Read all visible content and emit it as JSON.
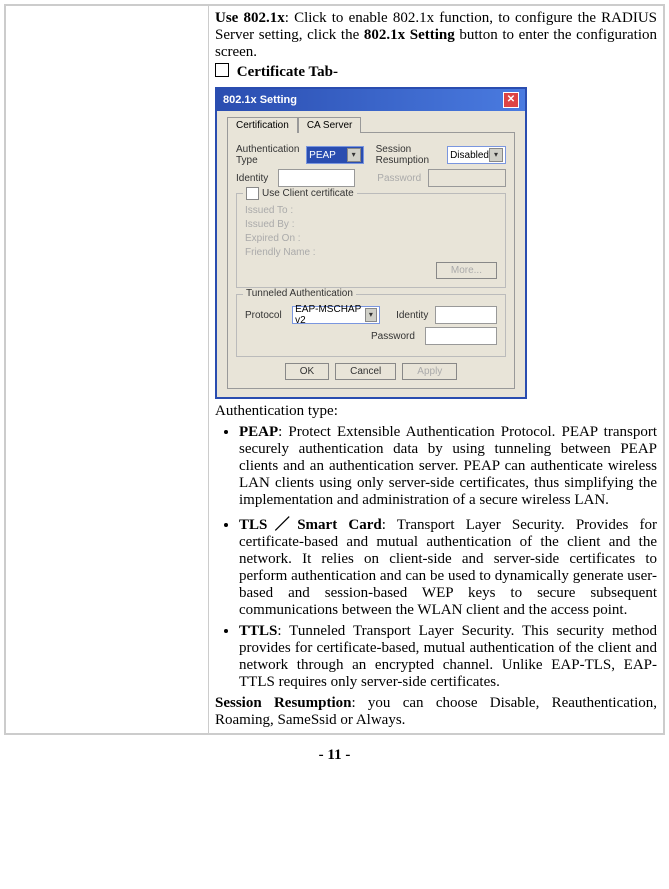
{
  "text": {
    "use8021x_label": "Use 802.1x",
    "use8021x_desc": ": Click to enable 802.1x function, to configure the RADIUS Server setting, click the ",
    "setting_bold": "802.1x Setting",
    "use8021x_tail": " button to enter the configuration screen.",
    "cert_tab": "Certificate Tab-",
    "auth_type_label": "Authentication type:",
    "peap_label": "PEAP",
    "peap_desc": ": Protect Extensible Authentication Protocol. PEAP transport securely authentication data by using tunneling between PEAP clients and an authentication server. PEAP can authenticate wireless LAN clients using only server-side certificates, thus simplifying the implementation and administration of a secure wireless LAN.",
    "tls_label": "TLS／Smart Card",
    "tls_desc": ": Transport Layer Security. Provides for certificate-based and mutual authentication of the client and the network. It relies on client-side and server-side certificates to perform authentication and can be used to dynamically generate user-based and session-based WEP keys to secure subsequent communications between the WLAN client and the access point.",
    "ttls_label": "TTLS",
    "ttls_desc": ": Tunneled Transport Layer Security. This security method provides for certificate-based, mutual authentication of the client and network through an encrypted channel. Unlike EAP-TLS, EAP-TTLS requires only server-side certificates.",
    "session_label": "Session Resumption",
    "session_desc": ": you can choose Disable, Reauthentication, Roaming, SameSsid or Always."
  },
  "dialog": {
    "title": "802.1x Setting",
    "tabs": {
      "cert": "Certification",
      "ca": "CA Server"
    },
    "auth_type": "Authentication Type",
    "auth_type_val": "PEAP",
    "session_resumption": "Session Resumption",
    "session_val": "Disabled",
    "identity": "Identity",
    "password": "Password",
    "use_client_cert": "Use Client certificate",
    "issued_to": "Issued To :",
    "issued_by": "Issued By :",
    "expired_on": "Expired On :",
    "friendly_name": "Friendly Name :",
    "more": "More...",
    "tunneled": "Tunneled Authentication",
    "protocol": "Protocol",
    "protocol_val": "EAP-MSCHAP v2",
    "identity2": "Identity",
    "password2": "Password",
    "ok": "OK",
    "cancel": "Cancel",
    "apply": "Apply"
  },
  "page_number": "- 11 -"
}
